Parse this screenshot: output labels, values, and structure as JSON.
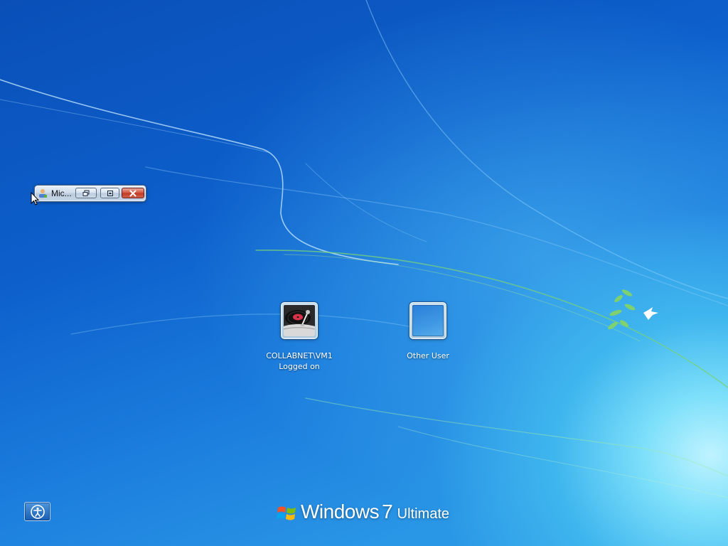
{
  "mini_window": {
    "title": "Mic...",
    "app_icon": "remote-desktop-icon",
    "buttons": [
      "restore-icon",
      "minimize-icon",
      "close-icon"
    ]
  },
  "users": [
    {
      "name": "COLLABNET\\VM1",
      "status": "Logged on",
      "picture": "turntable-icon"
    },
    {
      "name": "Other User",
      "status": "",
      "picture": "blank-user-icon"
    }
  ],
  "ease_of_access": {
    "icon": "ease-of-access-icon"
  },
  "branding": {
    "product": "Windows",
    "version": "7",
    "edition": "Ultimate",
    "logo": "windows-flag-icon"
  },
  "colors": {
    "desktop_blue": "#0d5fcb",
    "glow_cyan": "#7ee0fa",
    "close_red": "#c03a24"
  }
}
